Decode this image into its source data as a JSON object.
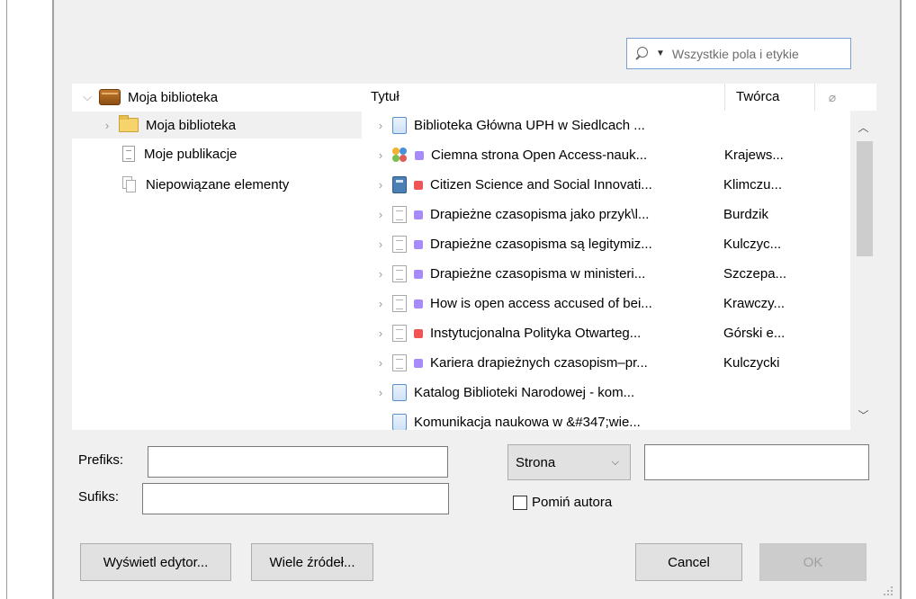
{
  "search": {
    "placeholder": "Wszystkie pola i etykie"
  },
  "tree": {
    "items": [
      {
        "label": "Moja biblioteka",
        "icon": "library-icon"
      },
      {
        "label": "Moja biblioteka",
        "icon": "folder-icon"
      },
      {
        "label": "Moje publikacje",
        "icon": "document-icon"
      },
      {
        "label": "Niepowiązane elementy",
        "icon": "unfiled-items-icon"
      }
    ]
  },
  "items": {
    "columns": {
      "title": "Tytuł",
      "creator": "Twórca"
    },
    "rows": [
      {
        "title": "Biblioteka Główna UPH w Siedlcach ...",
        "creator": "",
        "icon": "webpage-icon",
        "tag": ""
      },
      {
        "title": "Ciemna strona Open Access-nauk...",
        "creator": "Krajews...",
        "icon": "presentation-icon",
        "tag": "#a78bfa"
      },
      {
        "title": "Citizen Science and Social Innovati...",
        "creator": "Klimczu...",
        "icon": "book-icon",
        "tag": "#f05454"
      },
      {
        "title": "Drapieżne czasopisma jako przyk\\l...",
        "creator": "Burdzik",
        "icon": "journal-article-icon",
        "tag": "#a78bfa"
      },
      {
        "title": "Drapieżne czasopisma są legitymiz...",
        "creator": "Kulczyc...",
        "icon": "journal-article-icon",
        "tag": "#a78bfa"
      },
      {
        "title": "Drapieżne czasopisma w ministeri...",
        "creator": "Szczepa...",
        "icon": "journal-article-icon",
        "tag": "#a78bfa"
      },
      {
        "title": "How is open access accused of bei...",
        "creator": "Krawczy...",
        "icon": "journal-article-icon",
        "tag": "#a78bfa"
      },
      {
        "title": "Instytucjonalna Polityka Otwarteg...",
        "creator": "Górski e...",
        "icon": "journal-article-icon",
        "tag": "#f05454"
      },
      {
        "title": "Kariera drapieżnych czasopism–pr...",
        "creator": "Kulczycki",
        "icon": "journal-article-icon",
        "tag": "#a78bfa"
      },
      {
        "title": "Katalog Biblioteki Narodowej - kom...",
        "creator": "",
        "icon": "webpage-icon",
        "tag": ""
      },
      {
        "title": "Komunikacja naukowa w &#347;wie...",
        "creator": "",
        "icon": "webpage-icon",
        "tag": ""
      }
    ]
  },
  "fields": {
    "prefix_label": "Prefiks:",
    "suffix_label": "Sufiks:",
    "locator_select": "Strona",
    "omit_author_label": "Pomiń autora"
  },
  "buttons": {
    "show_editor": "Wyświetl edytor...",
    "multiple_sources": "Wiele źródeł...",
    "cancel": "Cancel",
    "ok": "OK"
  }
}
